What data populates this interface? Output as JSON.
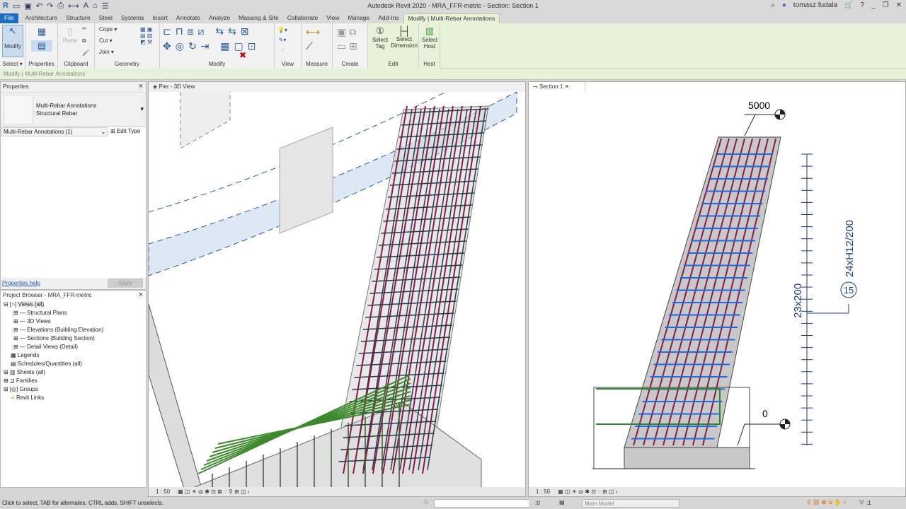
{
  "app_title": "Autodesk Revit 2020 - MRA_FFR-metric - Section: Section 1",
  "user": "tomasz.fudala",
  "tabs": [
    "File",
    "Architecture",
    "Structure",
    "Steel",
    "Systems",
    "Insert",
    "Annotate",
    "Analyze",
    "Massing & Site",
    "Collaborate",
    "View",
    "Manage",
    "Add-Ins",
    "Modify | Multi-Rebar Annotations"
  ],
  "ribbon": {
    "modify": "Modify",
    "select": "Select ▾",
    "properties": "Properties",
    "clipboard": "Clipboard",
    "paste": "Paste",
    "cope": "Cope ▾",
    "cut": "Cut ▾",
    "join": "Join ▾",
    "geometry": "Geometry",
    "modify_panel": "Modify",
    "view": "View",
    "measure": "Measure",
    "create": "Create",
    "select_tag": "Select Tag",
    "select_dimension": "Select Dimension",
    "select_host": "Select Host",
    "edit": "Edit",
    "host": "Host"
  },
  "options_bar": "Modify | Multi-Rebar Annotations",
  "properties": {
    "title": "Properties",
    "type_line1": "Multi-Rebar Annotations",
    "type_line2": "Structural Rebar",
    "selector": "Multi-Rebar Annotations (1)",
    "edit_type": "Edit Type",
    "help": "Properties help",
    "apply": "Apply"
  },
  "browser": {
    "title": "Project Browser - MRA_FFR-metric",
    "items": [
      "Views (all)",
      "Structural Plans",
      "3D Views",
      "Elevations (Building Elevation)",
      "Sections (Building Section)",
      "Detail Views (Detail)",
      "Legends",
      "Schedules/Quantities (all)",
      "Sheets (all)",
      "Families",
      "Groups",
      "Revit Links"
    ]
  },
  "views": {
    "left_tab": "Pier - 3D View",
    "right_tab": "Section 1",
    "left_scale": "1 : 50",
    "right_scale": "1 : 50"
  },
  "section": {
    "top_elev": "5000",
    "bottom_elev": "0",
    "dim_label": "23x200",
    "rebar_label": "24xH12/200",
    "tag": "15"
  },
  "status": {
    "hint": "Click to select, TAB for alternates, CTRL adds, SHIFT unselects.",
    "workset": ":0",
    "model": "Main Model",
    "filter": ":1"
  },
  "colors": {
    "ribbon_ctx": "#e8f2d8",
    "file_tab": "#1b6ec2",
    "rebar": "#8a1a4a",
    "distribution": "#1a6ae8",
    "tag_blue": "#1a3a8a"
  }
}
